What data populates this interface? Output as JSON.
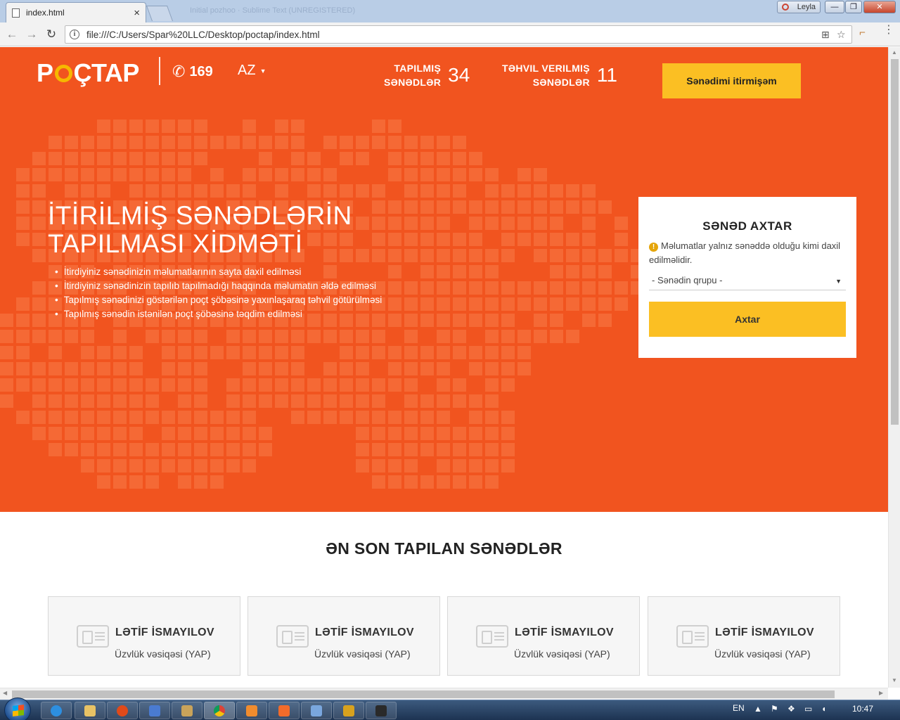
{
  "browser": {
    "tab_title": "index.html",
    "tab_close": "×",
    "background_tab_title": "Initial pozhoo · Sublime Text (UNREGISTERED)",
    "user_name": "Leyla",
    "url": "file:///C:/Users/Spar%20LLC/Desktop/poctap/index.html",
    "window_buttons": [
      "—",
      "❐",
      "✕"
    ]
  },
  "header": {
    "logo": {
      "before": "P",
      "after": "ÇTAP"
    },
    "phone": "169",
    "language": "AZ",
    "stats": [
      {
        "label_line1": "TAPILMIŞ",
        "label_line2": "SƏNƏDLƏR",
        "value": "34"
      },
      {
        "label_line1": "TƏHVIL VERILMIŞ",
        "label_line2": "SƏNƏDLƏR",
        "value": "11"
      }
    ],
    "lost_button": "Sənədimi itirmişəm"
  },
  "hero": {
    "title_line1": "İTİRİLMİŞ SƏNƏDLƏRİN",
    "title_line2": "TAPILMASI XİDMƏTİ",
    "bullets": [
      "İtirdiyiniz sənədinizin məlumatlarının sayta daxil edilməsi",
      "İtirdiyiniz sənədinizin tapılıb tapılmadığı haqqında məlumatın əldə edilməsi",
      "Tapılmış sənədinizi göstərilən poçt şöbəsinə yaxınlaşaraq təhvil götürülməsi",
      "Tapılmış sənədin istənilən poçt şöbəsinə təqdim edilməsi"
    ]
  },
  "search": {
    "title": "SƏNƏD AXTAR",
    "note": "Məlumatlar yalnız sənəddə olduğu kimi daxil edilməlidir.",
    "select_placeholder": "- Sənədin qrupu -",
    "button": "Axtar"
  },
  "latest": {
    "title": "ƏN SON TAPILAN SƏNƏDLƏR",
    "cards": [
      {
        "name": "LƏTİF İSMAYILOV",
        "doc": "Üzvlük vəsiqəsi (YAP)"
      },
      {
        "name": "LƏTİF İSMAYILOV",
        "doc": "Üzvlük vəsiqəsi (YAP)"
      },
      {
        "name": "LƏTİF İSMAYILOV",
        "doc": "Üzvlük vəsiqəsi (YAP)"
      },
      {
        "name": "LƏTİF İSMAYILOV",
        "doc": "Üzvlük vəsiqəsi (YAP)"
      }
    ]
  },
  "taskbar": {
    "language": "EN",
    "time": "10:47",
    "icons": [
      "ie-icon",
      "explorer-icon",
      "app-icon",
      "app-icon",
      "app-icon",
      "chrome-icon",
      "sublime-icon",
      "xampp-icon",
      "cube-icon",
      "filezilla-icon",
      "app-icon"
    ]
  }
}
